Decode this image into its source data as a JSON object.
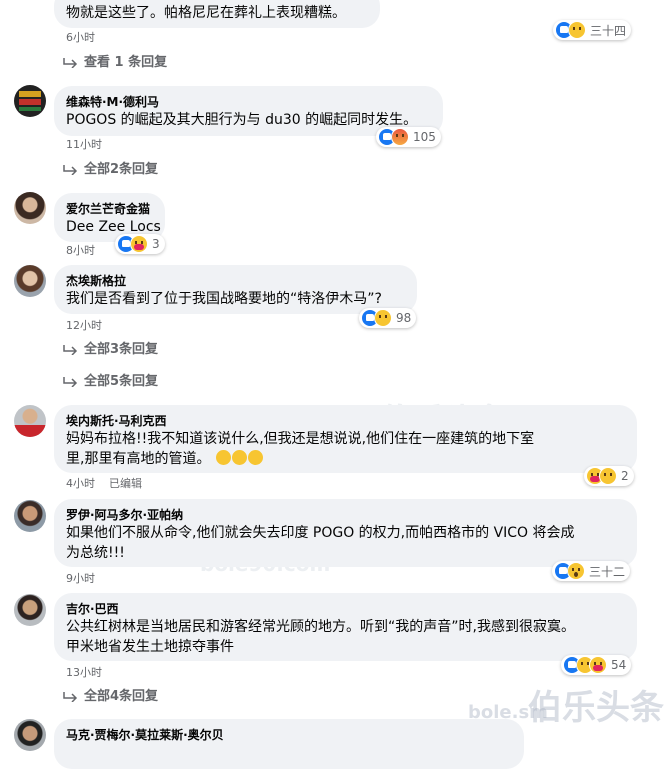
{
  "colors": {
    "bubble": "#f0f2f5",
    "meta": "#65676b",
    "like": "#1877f2",
    "emoji": "#f7c531"
  },
  "top": {
    "text": "物就是这些了。帕格尼尼在葬礼上表现糟糕。",
    "time": "6小时",
    "reactions_count": "三十四",
    "reply_link": "查看 1 条回复"
  },
  "comments": [
    {
      "author": "维森特·M·德利马",
      "lines": [
        "POGOS 的崛起及其大胆行为与 du30 的崛起同时发生。"
      ],
      "time": "11小时",
      "reactions_count": "105",
      "reactions": [
        "like-icon",
        "angry-icon"
      ],
      "replies": [
        "全部2条回复"
      ]
    },
    {
      "author": "爱尔兰芒奇金猫",
      "lines": [
        "Dee Zee Locs"
      ],
      "time": "8小时",
      "reactions_count": "3",
      "reactions": [
        "like-icon",
        "care-icon"
      ],
      "replies": []
    },
    {
      "author": "杰埃斯格拉",
      "lines": [
        "我们是否看到了位于我国战略要地的“特洛伊木马”?"
      ],
      "time": "12小时",
      "reactions_count": "98",
      "reactions": [
        "like-icon",
        "sad-icon"
      ],
      "replies": [
        "全部3条回复",
        "全部5条回复"
      ]
    },
    {
      "author": "埃内斯托·马利克西",
      "lines": [
        "妈妈布拉格!!我不知道该说什么,但我还是想说说,他们住在一座建筑的地下室",
        "里,那里有高地的管道。"
      ],
      "emoji_suffix": [
        "crying-face-icon",
        "crying-face-icon",
        "crying-face-icon"
      ],
      "time": "4小时",
      "edited": "已编辑",
      "reactions_count": "2",
      "reactions": [
        "care-icon",
        "sad-icon"
      ],
      "replies": []
    },
    {
      "author": "罗伊·阿马多尔·亚帕纳",
      "lines": [
        "如果他们不服从命令,他们就会失去印度 POGO 的权力,而帕西格市的 VICO 将会成",
        "为总统!!!"
      ],
      "time": "9小时",
      "reactions_count": "三十二",
      "reactions": [
        "like-icon",
        "wow-icon"
      ],
      "replies": []
    },
    {
      "author": "吉尔·巴西",
      "lines": [
        "公共红树林是当地居民和游客经常光顾的地方。听到“我的声音”时,我感到很寂寞。",
        "甲米地省发生土地掠夺事件"
      ],
      "time": "13小时",
      "reactions_count": "54",
      "reactions": [
        "like-icon",
        "sad-icon",
        "care-icon"
      ],
      "replies": [
        "全部4条回复"
      ]
    },
    {
      "author": "马克·贾梅尔·莫拉莱斯·奥尔贝",
      "lines": [],
      "time": "",
      "reactions_count": "",
      "reactions": [],
      "replies": []
    }
  ],
  "watermark": {
    "brand": "伯乐头条",
    "url": "bole90.com",
    "corner": "bole.sm"
  }
}
